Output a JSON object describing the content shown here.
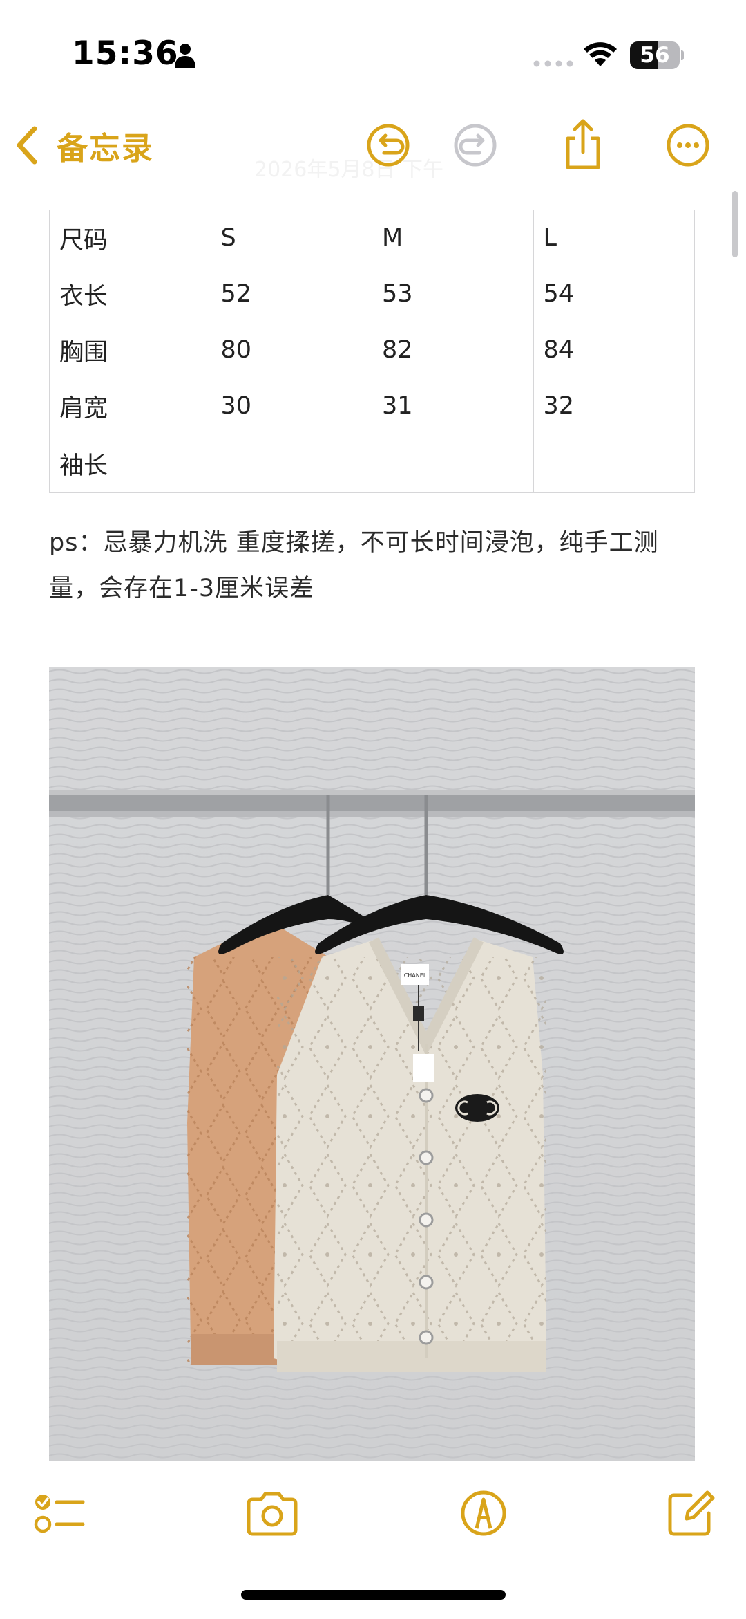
{
  "status_bar": {
    "time": "15:36",
    "battery_percent": "56"
  },
  "nav": {
    "back_label": "备忘录",
    "faint_date": "2026年5月8日 下午"
  },
  "size_table": {
    "rows": [
      [
        "尺码",
        "S",
        "M",
        "L"
      ],
      [
        "衣长",
        "52",
        "53",
        "54"
      ],
      [
        "胸围",
        "80",
        "82",
        "84"
      ],
      [
        "肩宽",
        "30",
        "31",
        "32"
      ],
      [
        "袖长",
        "",
        "",
        ""
      ]
    ]
  },
  "note": {
    "text": "ps：忌暴力机洗 重度揉搓，不可长时间浸泡，纯手工测量，会存在1-3厘米误差"
  },
  "photo": {
    "description_icon": "knit-vest-photo-icon",
    "logo_text": "CHANEL"
  },
  "colors": {
    "accent": "#d9a41a",
    "table_border": "#d6d6d8",
    "text": "#2b2b2b"
  },
  "icons": {
    "back": "chevron-left-icon",
    "undo": "undo-icon",
    "redo": "redo-icon",
    "share": "share-icon",
    "more": "more-icon",
    "checklist": "checklist-icon",
    "camera": "camera-icon",
    "markup": "markup-icon",
    "compose": "compose-icon"
  }
}
